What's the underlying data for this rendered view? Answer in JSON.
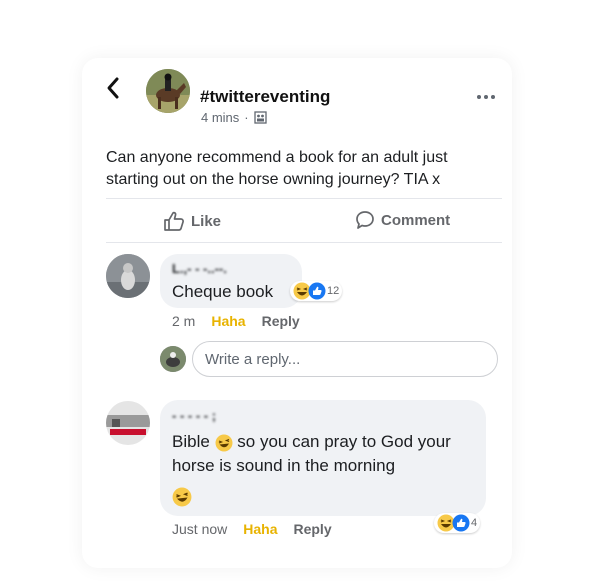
{
  "header": {
    "back_icon": "chevron-left-icon",
    "group_name": "#twittereventing",
    "timestamp": "4 mins",
    "separator": "·",
    "privacy_icon": "group-privacy-icon",
    "more_icon": "more-options-icon"
  },
  "post": {
    "text": "Can anyone recommend a book for an adult just starting out on the horse owning journey? TIA x"
  },
  "actions": {
    "like_label": "Like",
    "comment_label": "Comment"
  },
  "comments": [
    {
      "author": "L.,- - -..--.",
      "text": "Cheque book",
      "reaction_count": "12",
      "time": "2 m",
      "haha_label": "Haha",
      "reply_label": "Reply"
    },
    {
      "author": "- - -  - -  ;",
      "text": "Bible",
      "text_cont": "so you can pray to God your horse is sound in the morning",
      "reaction_count": "4",
      "time": "Just now",
      "haha_label": "Haha",
      "reply_label": "Reply"
    }
  ],
  "reply_box": {
    "placeholder": "Write a reply..."
  },
  "colors": {
    "haha": "#e8b300",
    "like_blue": "#1877f2",
    "bubble": "#f0f2f5",
    "text_gray": "#65676b"
  }
}
